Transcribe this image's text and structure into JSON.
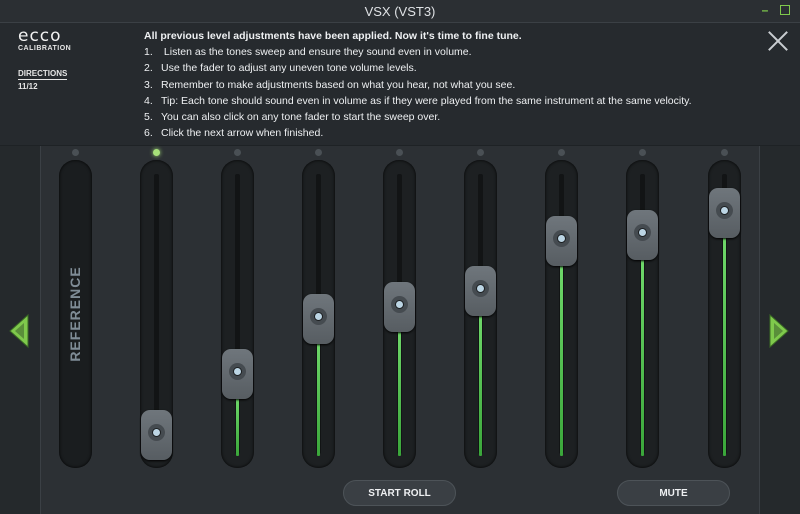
{
  "window": {
    "title": "VSX (VST3)",
    "minimize_glyph": "–"
  },
  "brand": {
    "logo": "ecco",
    "sub": "CALIBRATION"
  },
  "directions": {
    "label": "DIRECTIONS",
    "step": "11/12"
  },
  "instructions": {
    "heading": "All previous level adjustments have been applied. Now it's time to fine tune.",
    "steps": [
      {
        "num": "1.",
        "text": " Listen as the tones sweep and ensure they sound even in volume."
      },
      {
        "num": "2.",
        "text": "Use the fader to adjust any uneven tone volume levels."
      },
      {
        "num": "3.",
        "text": "Remember to make adjustments based on what you hear, not what you see."
      },
      {
        "num": "4.",
        "text": "Tip: Each tone should sound even in volume as if they were played from the same instrument at the same velocity."
      },
      {
        "num": "5.",
        "text": "You can also click on any tone fader to start the sweep over."
      },
      {
        "num": "6.",
        "text": "Click the next arrow when finished."
      }
    ]
  },
  "reference": {
    "label": "REFERENCE"
  },
  "faders": [
    {
      "id": 1,
      "level": 0.56,
      "active": true
    },
    {
      "id": 2,
      "level": 0.67,
      "active": false
    },
    {
      "id": 3,
      "level": 0.77,
      "active": false
    },
    {
      "id": 4,
      "level": 0.79,
      "active": false
    },
    {
      "id": 5,
      "level": 0.82,
      "active": false
    },
    {
      "id": 6,
      "level": 0.91,
      "active": false
    },
    {
      "id": 7,
      "level": 0.92,
      "active": false
    },
    {
      "id": 8,
      "level": 0.96,
      "active": false
    }
  ],
  "buttons": {
    "start_roll": "START ROLL",
    "mute": "MUTE"
  },
  "icons": {
    "prev": "chevron-left-icon",
    "next": "chevron-right-icon",
    "close": "close-icon"
  },
  "colors": {
    "accent": "#7fc94c",
    "fill": "#4cbf4c"
  }
}
